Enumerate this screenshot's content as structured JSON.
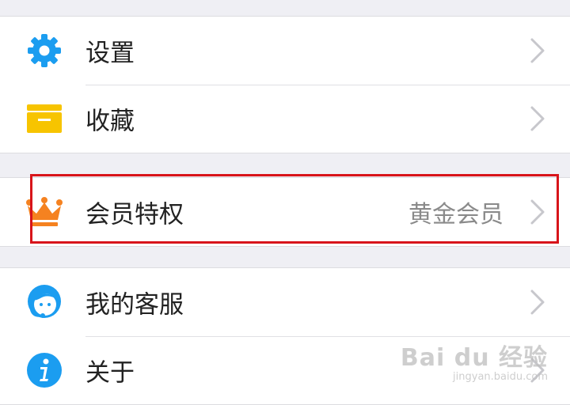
{
  "menu": {
    "group1": [
      {
        "label": "设置",
        "icon": "gear-icon",
        "icon_color": "#1b9df0"
      },
      {
        "label": "收藏",
        "icon": "box-icon",
        "icon_color": "#f7c400"
      }
    ],
    "group2": [
      {
        "label": "会员特权",
        "value": "黄金会员",
        "icon": "crown-icon",
        "icon_color": "#f58220"
      }
    ],
    "group3": [
      {
        "label": "我的客服",
        "icon": "customer-service-icon",
        "icon_color": "#1b9df0"
      },
      {
        "label": "关于",
        "icon": "info-icon",
        "icon_color": "#1b9df0"
      }
    ]
  },
  "highlight_color": "#d8141a",
  "watermark": {
    "brand": "Bai du 经验",
    "sub": "jingyan.baidu.com"
  }
}
